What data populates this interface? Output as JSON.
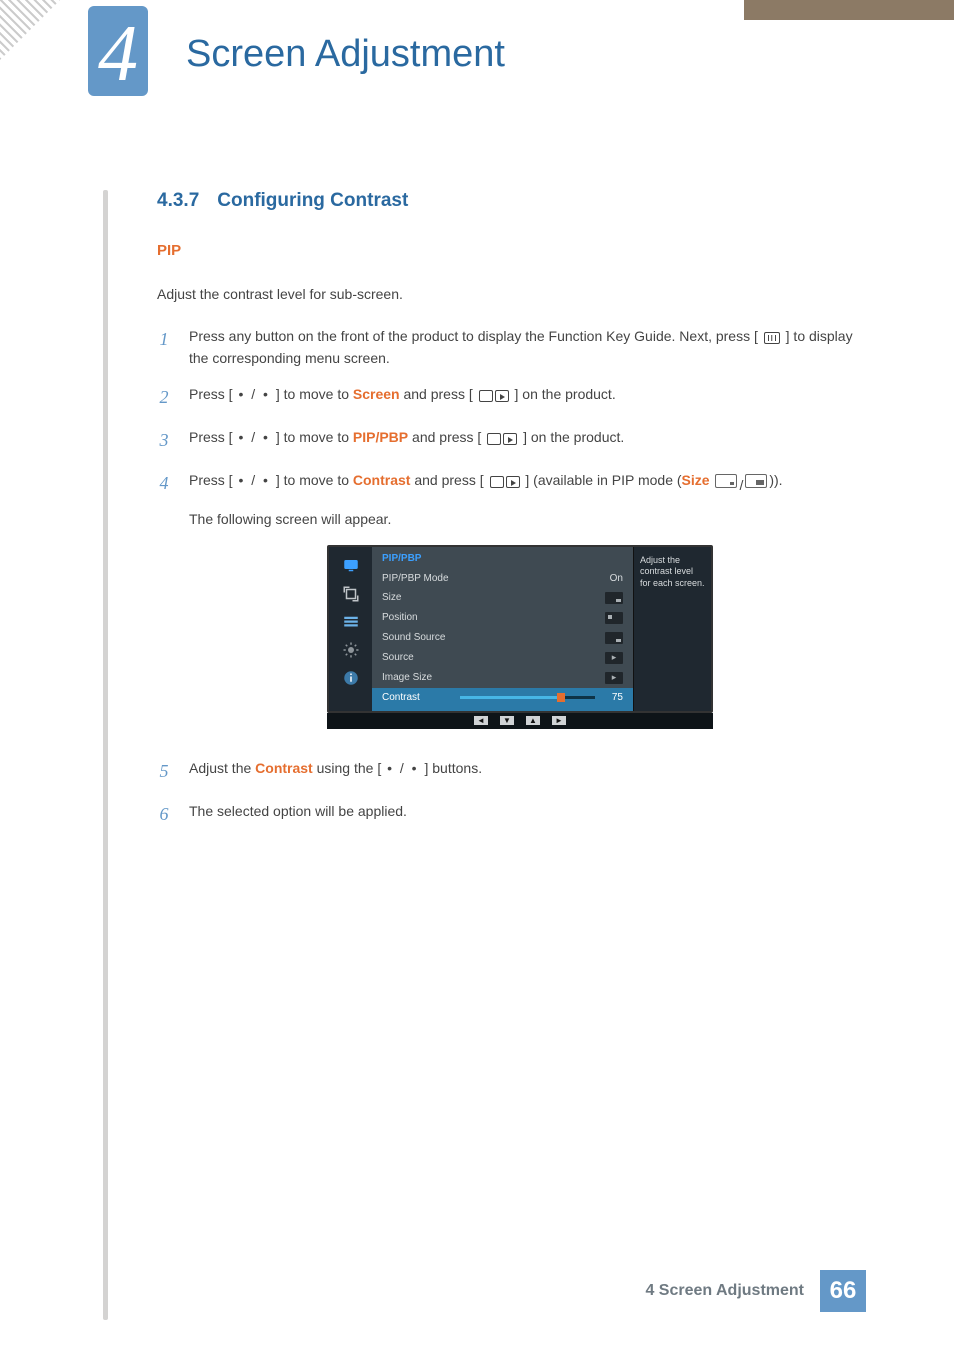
{
  "chapter": {
    "number": "4",
    "title": "Screen Adjustment"
  },
  "section": {
    "number": "4.3.7",
    "title": "Configuring Contrast"
  },
  "pip_heading": "PIP",
  "pip_para": "Adjust the contrast level for sub-screen.",
  "steps": {
    "s1": {
      "num": "1",
      "text_a": "Press any button on the front of the product to display the Function Key Guide. Next, press [",
      "text_b": "] to display the corresponding menu screen."
    },
    "s2": {
      "num": "2",
      "text_a": "Press [",
      "dots": " • / • ",
      "text_b": "] to move to ",
      "hl": "Screen",
      "text_c": " and press [",
      "text_d": "] on the product."
    },
    "s3": {
      "num": "3",
      "text_a": "Press [",
      "dots": " • / • ",
      "text_b": "] to move to ",
      "hl": "PIP/PBP",
      "text_c": " and press [",
      "text_d": "] on the product."
    },
    "s4": {
      "num": "4",
      "text_a": "Press [",
      "dots": " • / • ",
      "text_b": "] to move to ",
      "hl": "Contrast",
      "text_c": " and press [",
      "text_d": "] (available in PIP mode (",
      "hl2": "Size",
      "text_e": ")).",
      "sub": "The following screen will appear."
    },
    "s5": {
      "num": "5",
      "text_a": "Adjust the ",
      "hl": "Contrast",
      "text_b": " using the [",
      "dots": " • / • ",
      "text_c": "] buttons."
    },
    "s6": {
      "num": "6",
      "text": "The selected option will be applied."
    }
  },
  "osd": {
    "title": "PIP/PBP",
    "help": "Adjust the contrast level for each screen.",
    "rows": {
      "mode": {
        "label": "PIP/PBP Mode",
        "value": "On"
      },
      "size": {
        "label": "Size"
      },
      "position": {
        "label": "Position"
      },
      "sound": {
        "label": "Sound Source"
      },
      "source": {
        "label": "Source"
      },
      "image": {
        "label": "Image Size"
      },
      "contrast": {
        "label": "Contrast",
        "value": "75"
      }
    },
    "nav": {
      "left": "◄",
      "down": "▼",
      "up": "▲",
      "right": "►"
    }
  },
  "footer": {
    "text": "4 Screen Adjustment",
    "page": "66"
  }
}
